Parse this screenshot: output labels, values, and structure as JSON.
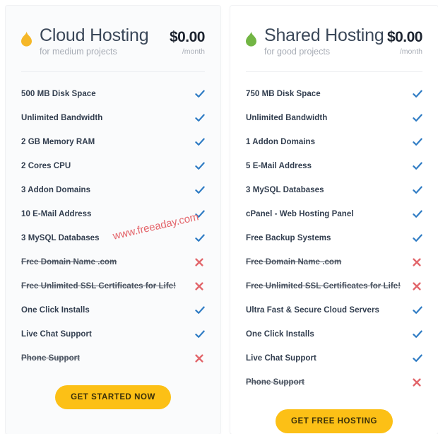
{
  "page": {
    "background_color": "#ffffff",
    "watermark": "www.freeaday.com",
    "watermark_color": "#e4656b",
    "accent_button_color": "#fcc016",
    "check_color": "#2f7cc4",
    "cross_color": "#e2666b"
  },
  "plans": [
    {
      "icon": "flame-icon",
      "icon_color": "#f5b728",
      "title": "Cloud Hosting",
      "subtitle": "for medium projects",
      "price": "$0.00",
      "period": "/month",
      "cta_label": "GET STARTED NOW",
      "features": [
        {
          "label": "500 MB Disk Space",
          "included": true
        },
        {
          "label": "Unlimited Bandwidth",
          "included": true
        },
        {
          "label": "2 GB Memory RAM",
          "included": true
        },
        {
          "label": "2 Cores CPU",
          "included": true
        },
        {
          "label": "3 Addon Domains",
          "included": true
        },
        {
          "label": "10 E-Mail Address",
          "included": true
        },
        {
          "label": "3 MySQL Databases",
          "included": true
        },
        {
          "label": "Free Domain Name .com",
          "included": false
        },
        {
          "label": "Free Unlimited SSL Certificates for Life!",
          "included": false
        },
        {
          "label": "One Click Installs",
          "included": true
        },
        {
          "label": "Live Chat Support",
          "included": true
        },
        {
          "label": "Phone Support",
          "included": false
        }
      ]
    },
    {
      "icon": "flame-icon",
      "icon_color": "#72b544",
      "title": "Shared Hosting",
      "subtitle": "for good projects",
      "price": "$0.00",
      "period": "/month",
      "cta_label": "GET FREE HOSTING",
      "features": [
        {
          "label": "750 MB Disk Space",
          "included": true
        },
        {
          "label": "Unlimited Bandwidth",
          "included": true
        },
        {
          "label": "1 Addon Domains",
          "included": true
        },
        {
          "label": "5 E-Mail Address",
          "included": true
        },
        {
          "label": "3 MySQL Databases",
          "included": true
        },
        {
          "label": "cPanel - Web Hosting Panel",
          "included": true
        },
        {
          "label": "Free Backup Systems",
          "included": true
        },
        {
          "label": "Free Domain Name .com",
          "included": false
        },
        {
          "label": "Free Unlimited SSL Certificates for Life!",
          "included": false
        },
        {
          "label": "Ultra Fast & Secure Cloud Servers",
          "included": true
        },
        {
          "label": "One Click Installs",
          "included": true
        },
        {
          "label": "Live Chat Support",
          "included": true
        },
        {
          "label": "Phone Support",
          "included": false
        }
      ]
    }
  ]
}
